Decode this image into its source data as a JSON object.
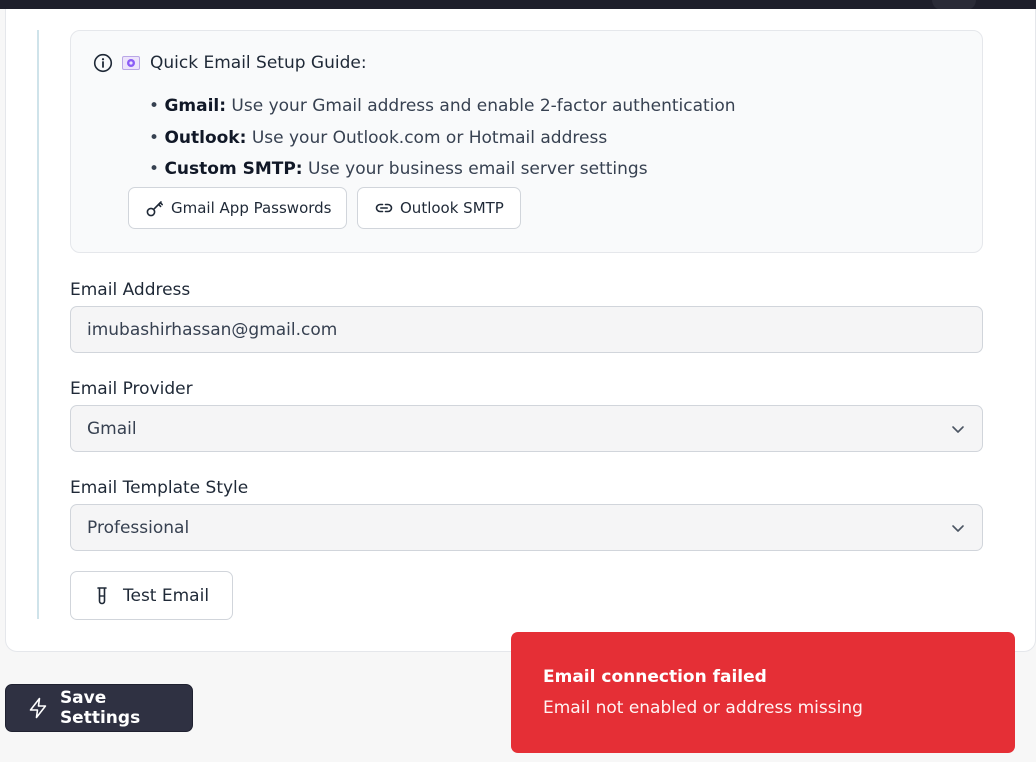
{
  "guide": {
    "title": "Quick Email Setup Guide:",
    "items": [
      {
        "bold": "Gmail:",
        "text": " Use your Gmail address and enable 2-factor authentication"
      },
      {
        "bold": "Outlook:",
        "text": " Use your Outlook.com or Hotmail address"
      },
      {
        "bold": "Custom SMTP:",
        "text": " Use your business email server settings"
      }
    ],
    "buttons": {
      "gmail": "Gmail App Passwords",
      "outlook": "Outlook SMTP"
    }
  },
  "form": {
    "email_label": "Email Address",
    "email_value": "imubashirhassan@gmail.com",
    "provider_label": "Email Provider",
    "provider_value": "Gmail",
    "template_label": "Email Template Style",
    "template_value": "Professional",
    "test_button": "Test Email"
  },
  "actions": {
    "save_button": "Save Settings"
  },
  "toast": {
    "title": "Email connection failed",
    "message": "Email not enabled or address missing"
  },
  "colors": {
    "toast_bg": "#e52f36",
    "save_bg": "#2f3142",
    "rule": "#cfe3ea"
  }
}
